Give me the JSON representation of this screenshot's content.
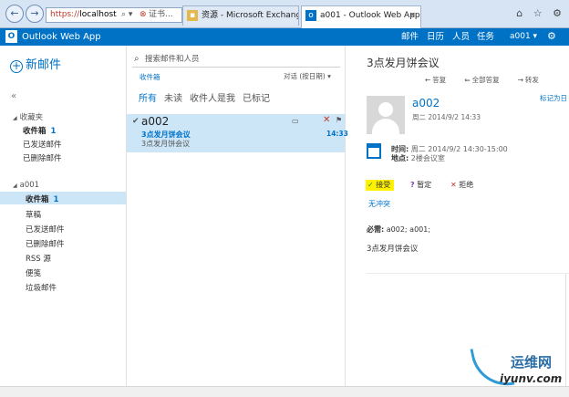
{
  "browser": {
    "address": {
      "protocol": "https://",
      "host": "localhost",
      "search_icon": "search-icon",
      "cert_label": "证书..."
    },
    "tabs": [
      {
        "label": "资源 - Microsoft Exchange"
      },
      {
        "label": "a001 - Outlook Web App",
        "close": "×"
      }
    ],
    "right_icons": "⌂ ☆ ⚙"
  },
  "owa": {
    "logo": "O",
    "title": "Outlook Web App",
    "nav": [
      "邮件",
      "日历",
      "人员",
      "任务"
    ],
    "user": "a001 ▾",
    "accent": "#0072c6"
  },
  "left_pane": {
    "new_mail": "新邮件",
    "collapse": "«",
    "favorites": {
      "header": "收藏夹",
      "items": [
        {
          "label": "收件箱",
          "count": "1"
        },
        {
          "label": "已发送邮件"
        },
        {
          "label": "已删除邮件"
        }
      ]
    },
    "account": {
      "header": "a001",
      "items": [
        {
          "label": "收件箱",
          "count": "1"
        },
        {
          "label": "草稿"
        },
        {
          "label": "已发送邮件"
        },
        {
          "label": "已删除邮件"
        },
        {
          "label": "RSS 源"
        },
        {
          "label": "便笺"
        },
        {
          "label": "垃圾邮件"
        }
      ]
    }
  },
  "message_list": {
    "search_placeholder": "搜索邮件和人员",
    "folder": "收件箱",
    "sort": "对话 (按日期) ▾",
    "filters": [
      "所有",
      "未读",
      "收件人是我",
      "已标记"
    ],
    "messages": [
      {
        "from": "a002",
        "subject": "3点发月饼会议",
        "preview": "3点发月饼会议",
        "time": "14:33"
      }
    ]
  },
  "reading_pane": {
    "title": "3点发月饼会议",
    "actions": [
      "答复",
      "全部答复",
      "转发"
    ],
    "calendar_link": "标记为日",
    "sender": "a002",
    "date": "周二 2014/9/2 14:33",
    "when_label": "时间:",
    "when_value": "周二 2014/9/2 14:30-15:00",
    "where_label": "地点:",
    "where_value": "2楼会议室",
    "responses": {
      "accept": "接受",
      "tentative": "暂定",
      "decline": "拒绝"
    },
    "conflict": "无冲突",
    "required_label": "必需:",
    "required_value": "a002; a001;",
    "body": "3点发月饼会议"
  },
  "watermark": {
    "cn": "运维网",
    "en": "iyunv.com"
  }
}
